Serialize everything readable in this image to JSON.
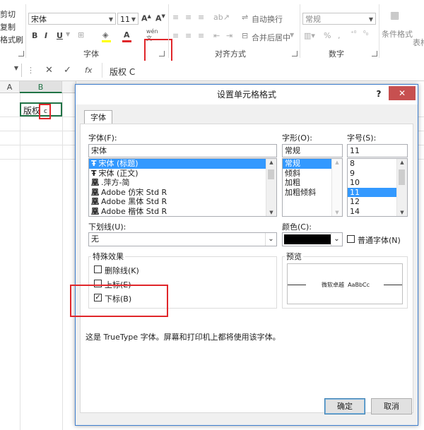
{
  "ribbon": {
    "clipboard": {
      "cut": "剪切",
      "copy": "复制",
      "format_painter": "格式刷"
    },
    "font_group": {
      "font_name": "宋体",
      "font_size": "11",
      "label": "字体",
      "bold": "B",
      "italic": "I",
      "underline": "U"
    },
    "align_group": {
      "wrap_text": "自动换行",
      "merge_center": "合并后居中",
      "label": "对齐方式"
    },
    "number_group": {
      "format": "常规",
      "percent": "%",
      "comma": ",",
      "label": "数字"
    },
    "styles": {
      "conditional": "条件格式",
      "table": "表格"
    }
  },
  "formula_bar": {
    "fx": "fx",
    "value": "版权 C"
  },
  "grid": {
    "col_a": "A",
    "col_b": "B",
    "cell_text": "版权",
    "cell_sub": "c"
  },
  "dialog": {
    "title": "设置单元格格式",
    "help": "?",
    "close": "✕",
    "tab": "字体",
    "font_label": "字体(F):",
    "font_value": "宋体",
    "font_list": [
      {
        "glyph": "Ŧ",
        "name": "宋体 (标题)",
        "selected": true
      },
      {
        "glyph": "Ŧ",
        "name": "宋体 (正文)",
        "selected": false
      },
      {
        "glyph": "凰",
        "name": ".萍方-简",
        "selected": false
      },
      {
        "glyph": "凰",
        "name": "Adobe 仿宋 Std R",
        "selected": false
      },
      {
        "glyph": "凰",
        "name": "Adobe 黑体 Std R",
        "selected": false
      },
      {
        "glyph": "凰",
        "name": "Adobe 楷体 Std R",
        "selected": false
      }
    ],
    "style_label": "字形(O):",
    "style_value": "常规",
    "style_list": [
      {
        "name": "常规",
        "selected": true
      },
      {
        "name": "倾斜",
        "selected": false
      },
      {
        "name": "加粗",
        "selected": false
      },
      {
        "name": "加粗倾斜",
        "selected": false
      }
    ],
    "size_label": "字号(S):",
    "size_value": "11",
    "size_list": [
      {
        "name": "8",
        "selected": false
      },
      {
        "name": "9",
        "selected": false
      },
      {
        "name": "10",
        "selected": false
      },
      {
        "name": "11",
        "selected": true
      },
      {
        "name": "12",
        "selected": false
      },
      {
        "name": "14",
        "selected": false
      }
    ],
    "underline_label": "下划线(U):",
    "underline_value": "无",
    "color_label": "颜色(C):",
    "color_value": "#000000",
    "normal_font": "普通字体(N)",
    "effects_label": "特殊效果",
    "strikethrough": "删除线(K)",
    "superscript": "上标(E)",
    "subscript": "下标(B)",
    "preview_label": "预览",
    "preview_text": "微软卓越  AaBbCc",
    "info": "这是 TrueType 字体。屏幕和打印机上都将使用该字体。",
    "ok": "确定",
    "cancel": "取消"
  }
}
